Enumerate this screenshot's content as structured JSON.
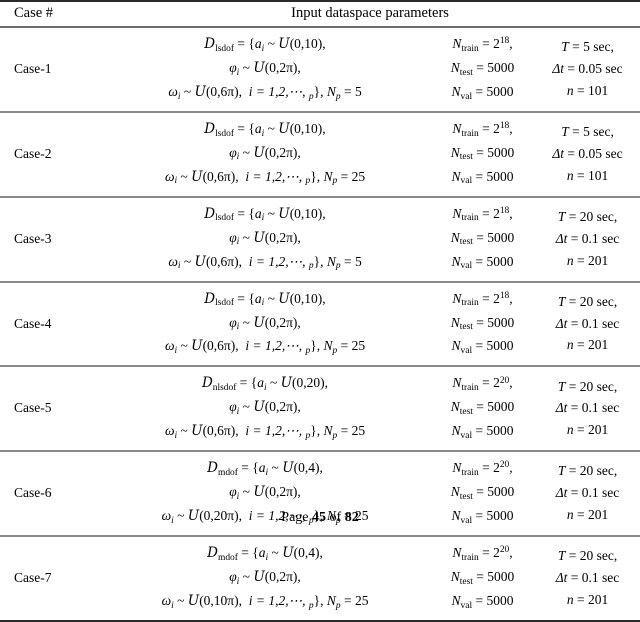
{
  "table": {
    "columns": {
      "case_header": "Case #",
      "input_header": "Input dataspace parameters"
    },
    "rows": [
      {
        "case": "Case-1",
        "dataspace_symbol": "D",
        "dataspace_subscript": "lsdof",
        "amplitude": "a",
        "amplitude_dist": "U(0,10)",
        "phase": "φ",
        "phase_dist": "U(0,2π)",
        "omega": "ω",
        "omega_dist": "U(0,6π)",
        "index_range": "i = 1,2,⋯, N",
        "np_value": "5",
        "n_train": "2",
        "n_train_exp": "18",
        "n_test": "5000",
        "n_val": "5000",
        "T": "5 sec,",
        "dt": "0.05 sec",
        "n": "101"
      },
      {
        "case": "Case-2",
        "dataspace_symbol": "D",
        "dataspace_subscript": "lsdof",
        "amplitude": "a",
        "amplitude_dist": "U(0,10)",
        "phase": "φ",
        "phase_dist": "U(0,2π)",
        "omega": "ω",
        "omega_dist": "U(0,6π)",
        "index_range": "i = 1,2,⋯, N",
        "np_value": "25",
        "n_train": "2",
        "n_train_exp": "18",
        "n_test": "5000",
        "n_val": "5000",
        "T": "5 sec,",
        "dt": "0.05 sec",
        "n": "101"
      },
      {
        "case": "Case-3",
        "dataspace_symbol": "D",
        "dataspace_subscript": "lsdof",
        "amplitude": "a",
        "amplitude_dist": "U(0,10)",
        "phase": "φ",
        "phase_dist": "U(0,2π)",
        "omega": "ω",
        "omega_dist": "U(0,6π)",
        "index_range": "i = 1,2,⋯, N",
        "np_value": "5",
        "n_train": "2",
        "n_train_exp": "18",
        "n_test": "5000",
        "n_val": "5000",
        "T": "20 sec,",
        "dt": "0.1 sec",
        "n": "201"
      },
      {
        "case": "Case-4",
        "dataspace_symbol": "D",
        "dataspace_subscript": "lsdof",
        "amplitude": "a",
        "amplitude_dist": "U(0,10)",
        "phase": "φ",
        "phase_dist": "U(0,2π)",
        "omega": "ω",
        "omega_dist": "U(0,6π)",
        "index_range": "i = 1,2,⋯, N",
        "np_value": "25",
        "n_train": "2",
        "n_train_exp": "18",
        "n_test": "5000",
        "n_val": "5000",
        "T": "20 sec,",
        "dt": "0.1 sec",
        "n": "201"
      },
      {
        "case": "Case-5",
        "dataspace_symbol": "D",
        "dataspace_subscript": "nlsdof",
        "amplitude": "a",
        "amplitude_dist": "U(0,20)",
        "phase": "φ",
        "phase_dist": "U(0,2π)",
        "omega": "ω",
        "omega_dist": "U(0,6π)",
        "index_range": "i = 1,2,⋯, N",
        "np_value": "25",
        "n_train": "2",
        "n_train_exp": "20",
        "n_test": "5000",
        "n_val": "5000",
        "T": "20 sec,",
        "dt": "0.1 sec",
        "n": "201"
      },
      {
        "case": "Case-6",
        "dataspace_symbol": "D",
        "dataspace_subscript": "mdof",
        "amplitude": "a",
        "amplitude_dist": "U(0,4)",
        "phase": "φ",
        "phase_dist": "U(0,2π)",
        "omega": "ω",
        "omega_dist": "U(0,20π)",
        "index_range": "i = 1,2,⋯, N",
        "np_value": "25",
        "n_train": "2",
        "n_train_exp": "20",
        "n_test": "5000",
        "n_val": "5000",
        "T": "20 sec,",
        "dt": "0.1 sec",
        "n": "201"
      },
      {
        "case": "Case-7",
        "dataspace_symbol": "D",
        "dataspace_subscript": "mdof",
        "amplitude": "a",
        "amplitude_dist": "U(0,4)",
        "phase": "φ",
        "phase_dist": "U(0,2π)",
        "omega": "ω",
        "omega_dist": "U(0,10π)",
        "index_range": "i = 1,2,⋯, N",
        "np_value": "25",
        "n_train": "2",
        "n_train_exp": "20",
        "n_test": "5000",
        "n_val": "5000",
        "T": "20 sec,",
        "dt": "0.1 sec",
        "n": "201"
      }
    ]
  },
  "symbols": {
    "N": "N",
    "sub_train": "train",
    "sub_test": "test",
    "sub_val": "val",
    "sub_p": "p",
    "sub_i": "i",
    "T": "T",
    "delta_t": "Δt",
    "n": "n",
    "equals": "=",
    "tilde": "~",
    "open_brace": "{",
    "close_brace": "}",
    "comma": ",",
    "np_label": "N"
  },
  "footer": {
    "prefix": "Page ",
    "page_number": "45",
    "middle": " of ",
    "total_pages": "82"
  }
}
